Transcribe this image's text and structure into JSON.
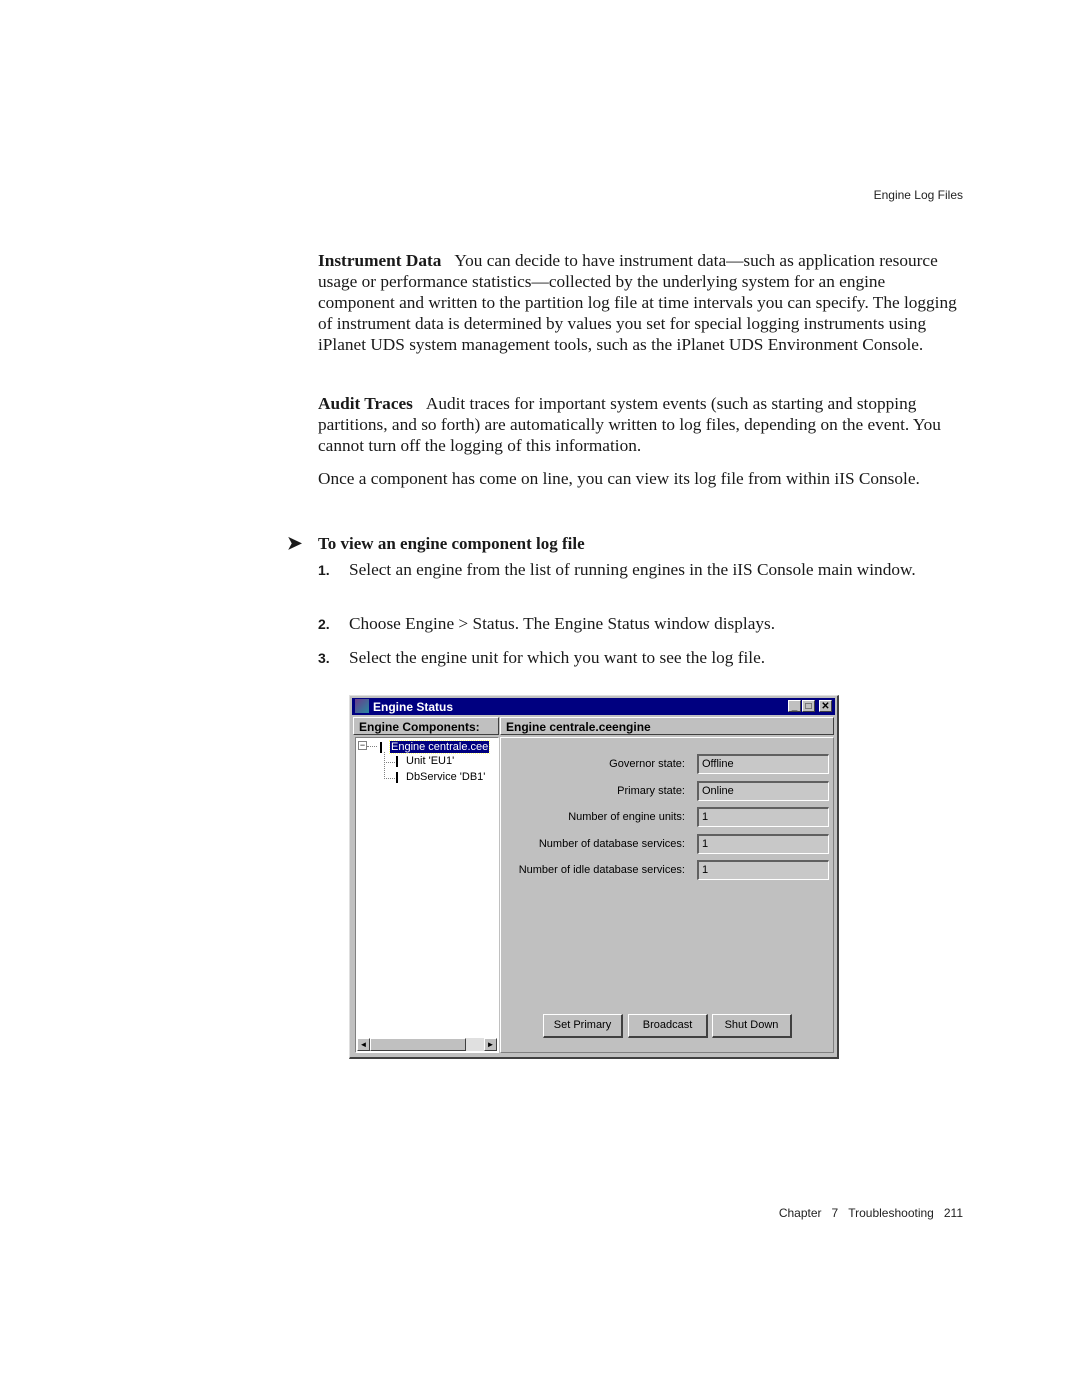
{
  "running_head": "Engine Log Files",
  "paragraphs": [
    {
      "lead": "Instrument Data",
      "text": "You can decide to have instrument data—such as application resource usage or performance statistics—collected by the underlying system for an engine component and written to the partition log file at time intervals you can specify. The logging of instrument data is determined by values you set for special logging instruments using iPlanet UDS system management tools, such as the iPlanet UDS Environment Console."
    },
    {
      "lead": "Audit Traces",
      "text": "Audit traces for important system events (such as starting and stopping partitions, and so forth) are automatically written to log files, depending on the event. You cannot turn off the logging of this information."
    },
    {
      "lead": "",
      "text": "Once a component has come on line, you can view its log file from within iIS Console."
    }
  ],
  "procedure": {
    "title": "To view an engine component log file",
    "steps": [
      {
        "num": "1.",
        "text": "Select an engine from the list of running engines in the iIS Console main window."
      },
      {
        "num": "2.",
        "text": "Choose Engine > Status. The Engine Status window displays."
      },
      {
        "num": "3.",
        "text": "Select the engine unit for which you want to see the log file."
      }
    ]
  },
  "window": {
    "title": "Engine Status",
    "controls": {
      "minimize": "_",
      "maximize": "□",
      "close": "✕"
    },
    "left_header": "Engine Components:",
    "right_header": "Engine centrale.ceengine",
    "tree": [
      {
        "label": "Engine centrale.cee",
        "selected": true,
        "expander": "−"
      },
      {
        "label": "Unit 'EU1'"
      },
      {
        "label": "DbService 'DB1'"
      }
    ],
    "fields": [
      {
        "label": "Governor state:",
        "value": "Offline"
      },
      {
        "label": "Primary state:",
        "value": "Online"
      },
      {
        "label": "Number of engine units:",
        "value": "1"
      },
      {
        "label": "Number of database services:",
        "value": "1"
      },
      {
        "label": "Number of idle database services:",
        "value": "1"
      }
    ],
    "buttons": {
      "set_primary": "Set Primary",
      "broadcast": "Broadcast",
      "shut_down": "Shut Down"
    },
    "scroll_icons": {
      "left": "◄",
      "right": "►"
    }
  },
  "footer": {
    "chapter_label": "Chapter",
    "chapter_num": "7",
    "chapter_title": "Troubleshooting",
    "page": "211"
  },
  "arrow_glyph": "➤"
}
